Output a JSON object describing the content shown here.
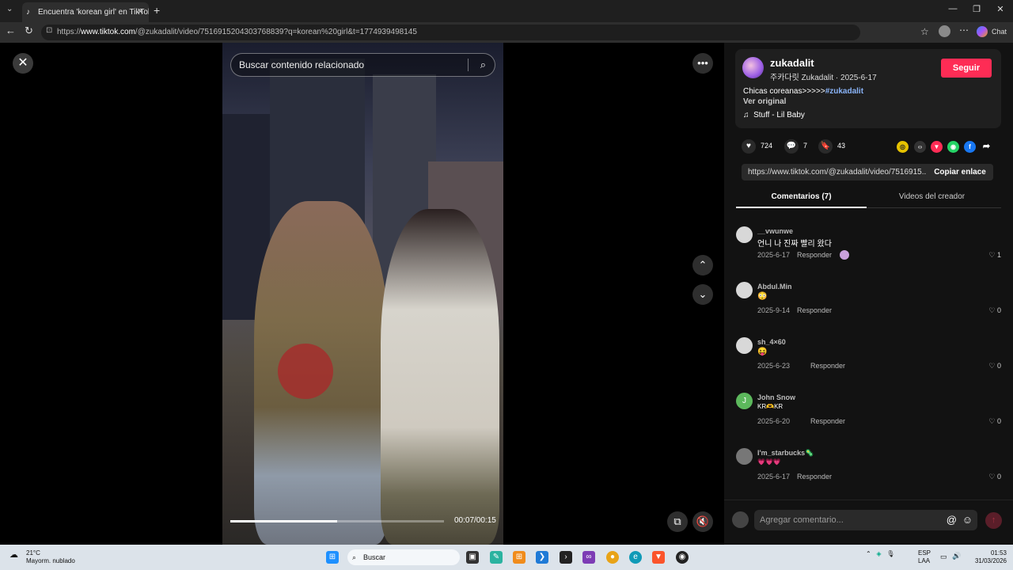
{
  "browser": {
    "tab_title": "Encuentra 'korean girl' en TikTok |",
    "tab_close": "✕",
    "new_tab": "+",
    "url_prefix": "https://",
    "url_host": "www.tiktok.com",
    "url_path": "/@zukadalit/video/7516915204303768839?q=korean%20girl&t=1774939498145",
    "chat_label": "Chat"
  },
  "video": {
    "search_placeholder": "Buscar contenido relacionado",
    "timecode": "00:07/00:15",
    "progress": 0.5
  },
  "author": {
    "username": "zukadalit",
    "subline": "주카다릿 Zukadalit · 2025-6-17",
    "follow_label": "Seguir",
    "description": "Chicas coreanas>>>>>",
    "hashtag": "#zukadalit",
    "see_original": "Ver original",
    "music": "Stuff - Lil Baby"
  },
  "stats": {
    "likes": "724",
    "comments": "7",
    "saves": "43"
  },
  "share": {
    "link": "https://www.tiktok.com/@zukadalit/video/7516915...",
    "copy_label": "Copiar enlace"
  },
  "tabs": {
    "comments": "Comentarios (7)",
    "creator_videos": "Videos del creador"
  },
  "comments": [
    {
      "user": "__vwunwe",
      "text": "언니 나 진짜 빨리 왔다",
      "date": "2025-6-17",
      "reply": "Responder",
      "likes": "1"
    },
    {
      "user": "Abdul.Min",
      "text": "😳",
      "date": "2025-9-14",
      "reply": "Responder",
      "likes": "0"
    },
    {
      "user": "sh_4×60",
      "text": "😝",
      "date": "2025-6-23",
      "reply": "Responder",
      "likes": "0"
    },
    {
      "user": "John Snow",
      "text": "KR🫶KR",
      "date": "2025-6-20",
      "reply": "Responder",
      "likes": "0"
    },
    {
      "user": "I'm_starbucks🦠",
      "text": "💗💗💗",
      "date": "2025-6-17",
      "reply": "Responder",
      "likes": "0"
    }
  ],
  "comment_input": {
    "placeholder": "Agregar comentario..."
  },
  "taskbar": {
    "temperature": "21°C",
    "weather": "Mayorm. nublado",
    "search_label": "Buscar",
    "lang_1": "ESP",
    "lang_2": "LAA",
    "time": "01:53",
    "date": "31/03/2026"
  },
  "colors": {
    "accent": "#fe2c55",
    "hashtag": "#8ab4f8"
  }
}
